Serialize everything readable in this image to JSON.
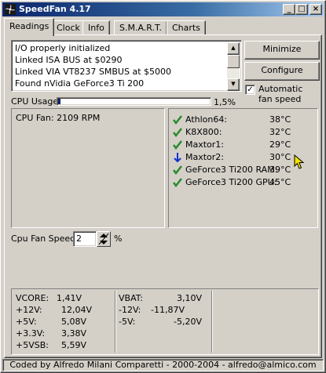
{
  "window": {
    "title": "SpeedFan 4.17",
    "icon": "fan-icon",
    "controls": [
      "_",
      "□",
      "×"
    ]
  },
  "tabs": [
    "Readings",
    "Clock",
    "Info",
    "S.M.A.R.T.",
    "Charts"
  ],
  "active_tab": "Readings",
  "log": {
    "lines": [
      "I/O properly initialized",
      "Linked ISA BUS at $0290",
      "Linked VIA VT8237 SMBUS at $5000",
      "Found nVidia GeForce3 Ti 200"
    ]
  },
  "buttons": {
    "minimize": "Minimize",
    "configure": "Configure"
  },
  "auto_fan": {
    "label": "Automatic fan speed",
    "checked": true
  },
  "cpu_usage": {
    "label": "CPU Usage",
    "percent_text": "1,5%",
    "fraction": 0.015
  },
  "fans": {
    "line": "CPU Fan: 2109 RPM"
  },
  "temps": [
    {
      "name": "Athlon64:",
      "value": "38°C",
      "icon": "check-icon"
    },
    {
      "name": "K8X800:",
      "value": "32°C",
      "icon": "check-icon"
    },
    {
      "name": "Maxtor1:",
      "value": "29°C",
      "icon": "check-icon"
    },
    {
      "name": "Maxtor2:",
      "value": "30°C",
      "icon": "arrow-down-icon"
    },
    {
      "name": "GeForce3 Ti200 RAM:",
      "value": "39°C",
      "icon": "check-icon"
    },
    {
      "name": "GeForce3 Ti200 GPU:",
      "value": "45°C",
      "icon": "check-icon"
    }
  ],
  "fan_speed": {
    "label": "Cpu Fan Speed:",
    "value": "2",
    "unit": "%"
  },
  "voltages_left": [
    {
      "label": "VCORE:",
      "value": "1,41V"
    },
    {
      "label": "+12V:",
      "value": "12,04V"
    },
    {
      "label": "+5V:",
      "value": "5,08V"
    },
    {
      "label": "+3.3V:",
      "value": "3,38V"
    },
    {
      "label": "+5VSB:",
      "value": "5,59V"
    }
  ],
  "voltages_right": [
    {
      "label": "VBAT:",
      "value": "3,10V"
    },
    {
      "label": "-12V:",
      "value": "-11,87V"
    },
    {
      "label": "-5V:",
      "value": "-5,20V"
    }
  ],
  "status": "Coded by Alfredo Milani Comparetti - 2000-2004 - alfredo@almico.com",
  "colors": {
    "check": "#2a8a2a",
    "arrow_down": "#1030d0",
    "cpu_bar": "#0a246a",
    "titlebar": "#0a246a"
  }
}
